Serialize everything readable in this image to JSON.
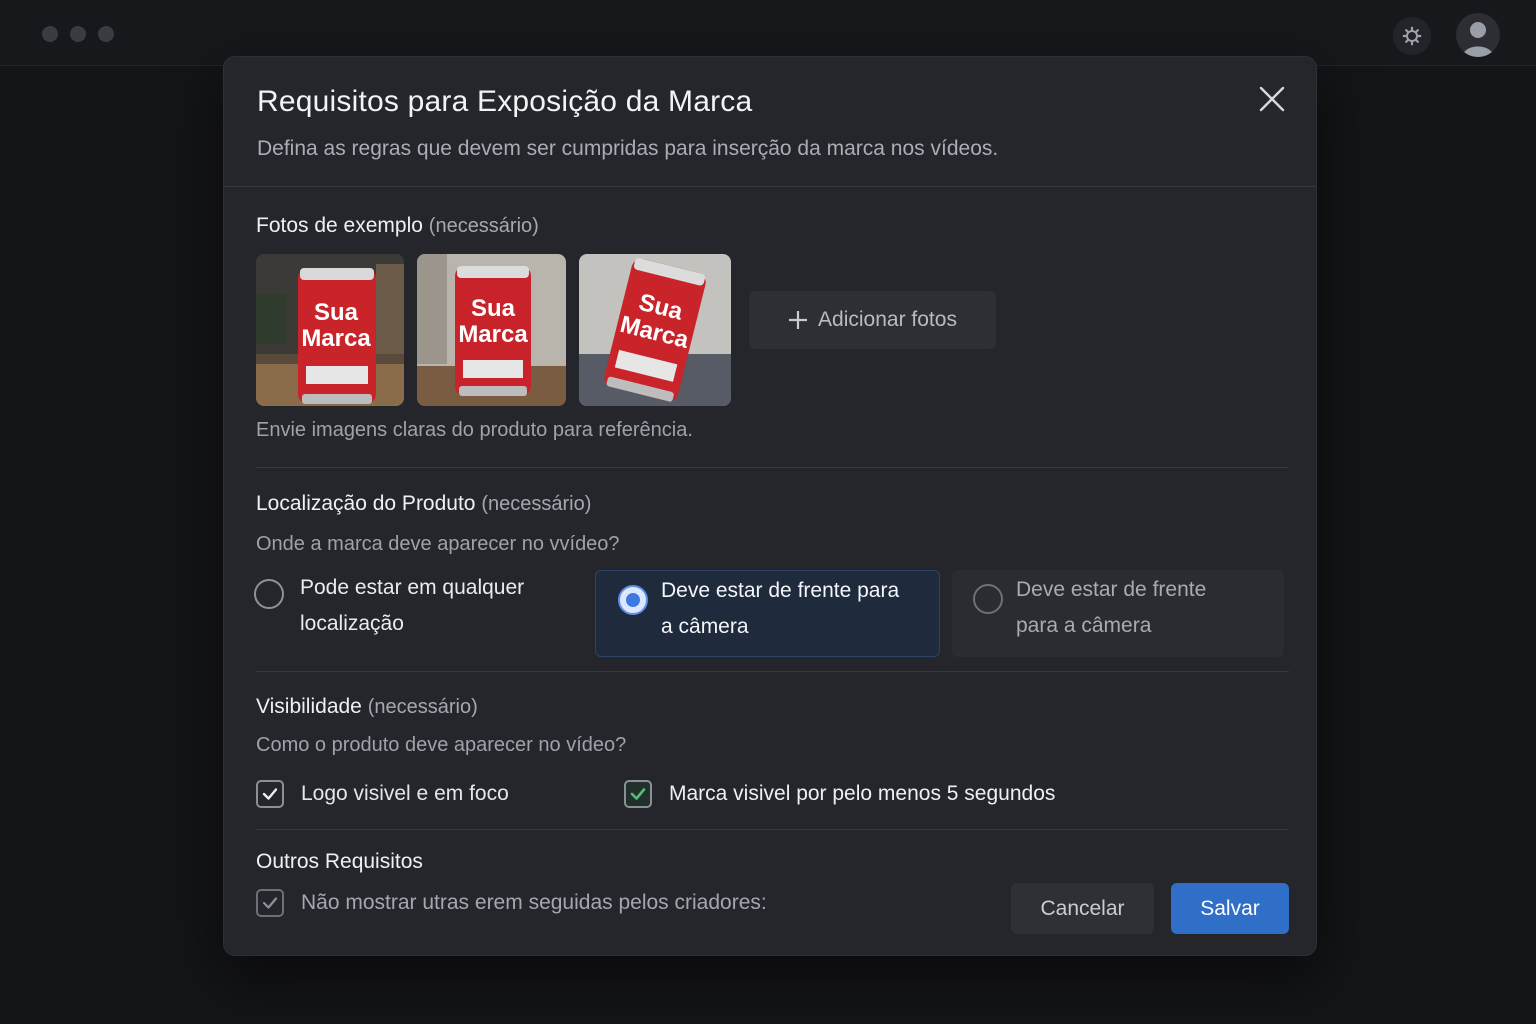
{
  "window": {
    "icons": [
      "window-dot",
      "window-dot",
      "window-dot",
      "gear-icon",
      "user-avatar-icon"
    ]
  },
  "modal": {
    "title": "Requisitos para Exposição da Marca",
    "subtitle": "Defina as regras que devem ser cumpridas para inserção da marca nos vídeos."
  },
  "photos_section": {
    "label": "Fotos de exemplo",
    "required": "(necessário)",
    "can_text_line1": "Sua",
    "can_text_line2": "Marca",
    "add_label": "Adicionar fotos",
    "help": "Envie imagens claras do produto para referência."
  },
  "location_section": {
    "label": "Localização do Produto",
    "required": "(necessário)",
    "question": "Onde a marca deve aparecer no vvídeo?",
    "options": [
      {
        "line1": "Pode estar em qualquer",
        "line2": "localização",
        "selected": false
      },
      {
        "line1": "Deve estar de frente para",
        "line2": "a câmera",
        "selected": true
      },
      {
        "line1": "Deve estar de frente",
        "line2": "para a câmera",
        "selected": false
      }
    ]
  },
  "visibility_section": {
    "label": "Visibilidade",
    "required": "(necessário)",
    "question": "Como o produto deve aparecer no vídeo?",
    "checks": [
      {
        "label": "Logo visivel e em foco",
        "checked": true
      },
      {
        "label": "Marca visivel por pelo menos 5 segundos",
        "checked": true
      }
    ]
  },
  "other_section": {
    "label": "Outros Requisitos",
    "check_label": "Não mostrar utras erem seguidas pelos criadores:",
    "checked": true
  },
  "actions": {
    "cancel": "Cancelar",
    "save": "Salvar"
  },
  "colors": {
    "accent": "#2f6fc8",
    "selected_bg": "#1f2a3d",
    "check_green": "#4fbf7a"
  }
}
